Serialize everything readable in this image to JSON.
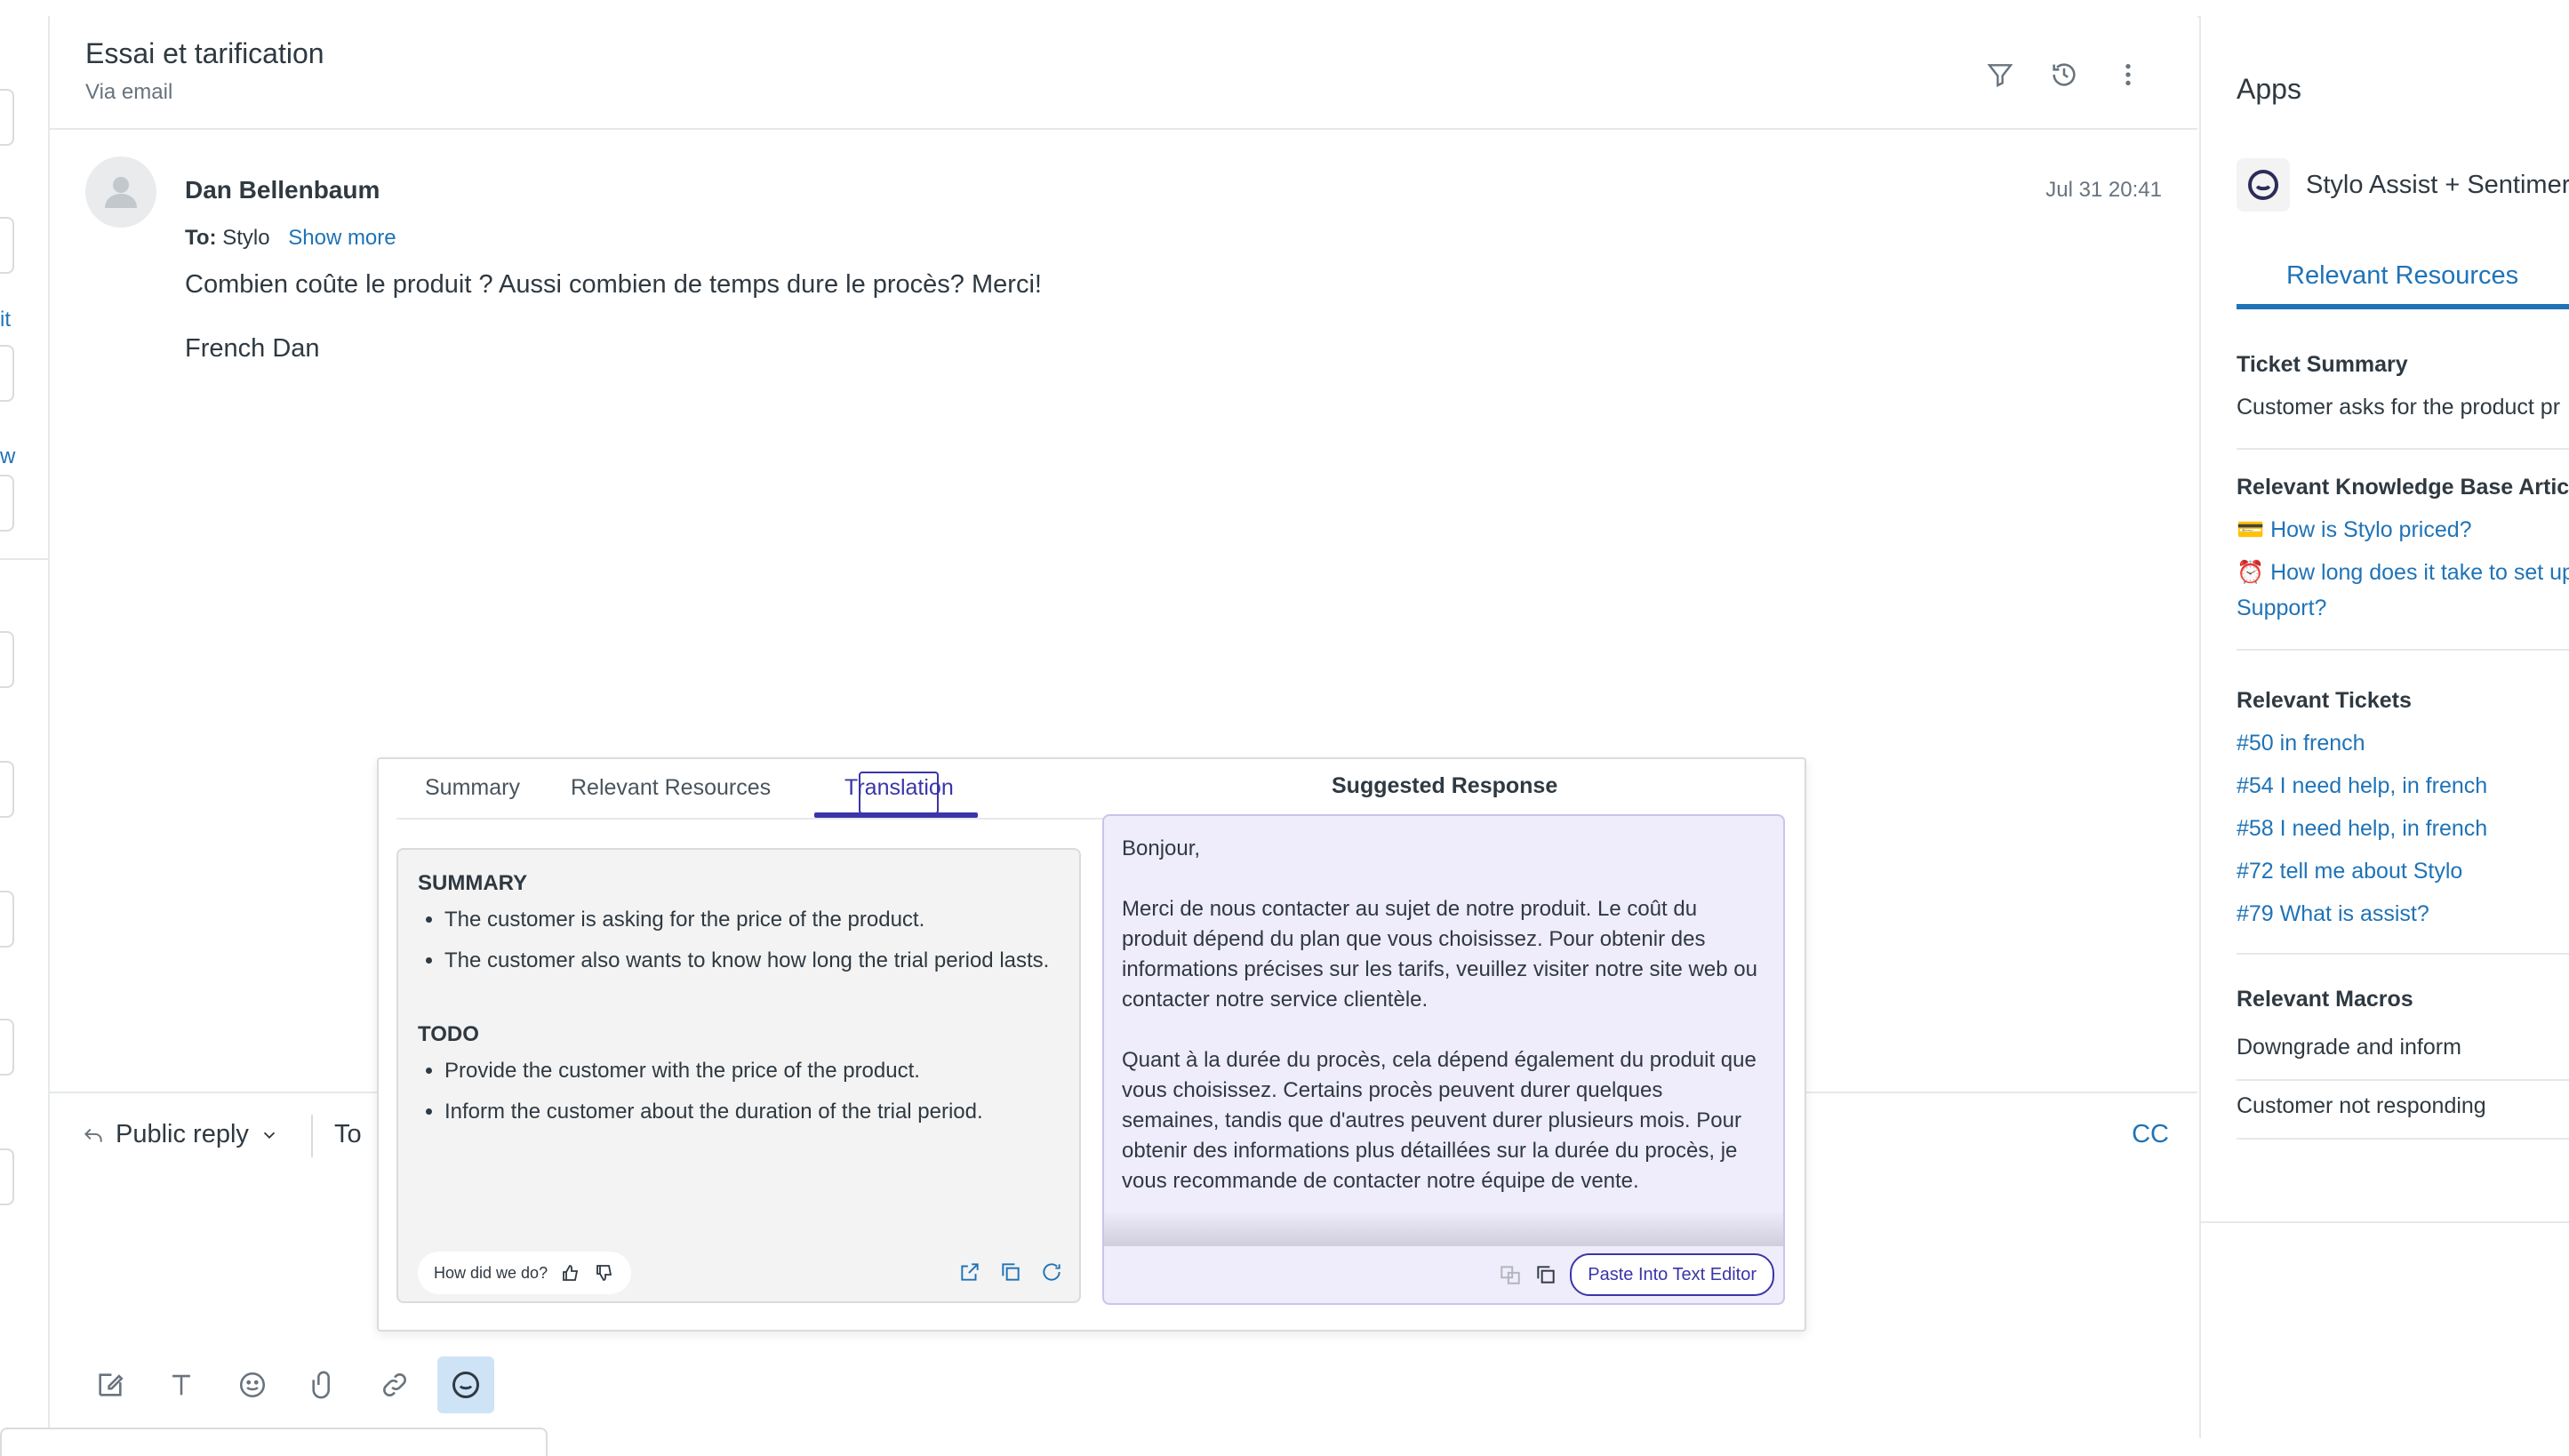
{
  "left": {
    "links": [
      "it",
      "w"
    ]
  },
  "ticket": {
    "title": "Essai et tarification",
    "channel": "Via email"
  },
  "header_icons": [
    "filter-icon",
    "history-icon",
    "more-vertical-icon"
  ],
  "message": {
    "sender": "Dan Bellenbaum",
    "time": "Jul 31 20:41",
    "to_label": "To:",
    "to_value": "Stylo",
    "show_more": "Show more",
    "body": "Combien coûte le produit ? Aussi combien de temps dure le procès? Merci!",
    "signature": "French Dan"
  },
  "reply": {
    "type": "Public reply",
    "to": "To",
    "cc": "CC"
  },
  "popover": {
    "tabs": [
      {
        "label": "Summary"
      },
      {
        "label": "Relevant Resources"
      },
      {
        "label": "Translation"
      }
    ],
    "summary": {
      "heading1": "SUMMARY",
      "items1": [
        "The customer is asking for the price of the product.",
        "The customer also wants to know how long the trial period lasts."
      ],
      "heading2": "TODO",
      "items2": [
        "Provide the customer with the price of the product.",
        "Inform the customer about the duration of the trial period."
      ],
      "feedback": "How did we do?"
    },
    "suggested": {
      "title": "Suggested Response",
      "text": "Bonjour,\n\nMerci de nous contacter au sujet de notre produit. Le coût du produit dépend du plan que vous choisissez. Pour obtenir des informations précises sur les tarifs, veuillez visiter notre site web ou contacter notre service clientèle.\n\nQuant à la durée du procès, cela dépend également du produit que vous choisissez. Certains procès peuvent durer quelques semaines, tandis que d'autres peuvent durer plusieurs mois. Pour obtenir des informations plus détaillées sur la durée du procès, je vous recommande de contacter notre équipe de vente.",
      "paste_button": "Paste Into Text Editor"
    }
  },
  "apps": {
    "title": "Apps",
    "app_name": "Stylo Assist + Sentimer",
    "tab": "Relevant Resources",
    "ticket_summary_heading": "Ticket Summary",
    "ticket_summary_text": "Customer asks for the product pr",
    "kb_heading": "Relevant Knowledge Base Artic",
    "kb_links": [
      "💳 How is Stylo priced?",
      "⏰ How long does it take to set up",
      "Support?"
    ],
    "tickets_heading": "Relevant Tickets",
    "tickets": [
      "#50 in french",
      "#54 I need help, in french",
      "#58 I need help, in french",
      "#72 tell me about Stylo",
      "#79 What is assist?"
    ],
    "macros_heading": "Relevant Macros",
    "macros": [
      "Downgrade and inform",
      "Customer not responding"
    ]
  }
}
